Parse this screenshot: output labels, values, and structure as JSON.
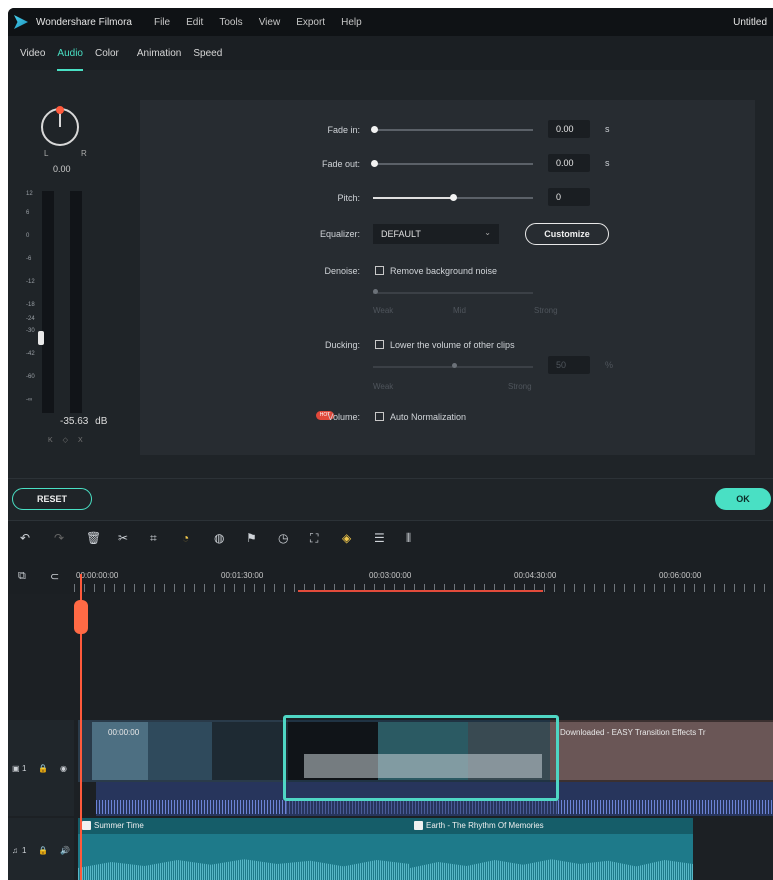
{
  "menubar": {
    "app_name": "Wondershare Filmora",
    "menus": [
      "File",
      "Edit",
      "Tools",
      "View",
      "Export",
      "Help"
    ],
    "window_title": "Untitled"
  },
  "tabs": [
    "Video",
    "Audio",
    "Color",
    "Animation",
    "Speed"
  ],
  "active_tab": "Audio",
  "meter": {
    "left_label": "L",
    "right_label": "R",
    "balance_value": "0.00",
    "scale": [
      "12",
      "6",
      "0",
      "-6",
      "-12",
      "-18",
      "-24",
      "-30",
      "-42",
      "-60",
      "-∞"
    ],
    "readout_value": "-35.63",
    "readout_unit": "dB",
    "icons": "K ◇ X"
  },
  "audio": {
    "fade_in_label": "Fade in:",
    "fade_in_value": "0.00",
    "fade_in_unit": "s",
    "fade_out_label": "Fade out:",
    "fade_out_value": "0.00",
    "fade_out_unit": "s",
    "pitch_label": "Pitch:",
    "pitch_value": "0",
    "equalizer_label": "Equalizer:",
    "equalizer_value": "DEFAULT",
    "customize_label": "Customize",
    "denoise_label": "Denoise:",
    "denoise_checkbox": "Remove background noise",
    "denoise_weak": "Weak",
    "denoise_mid": "Mid",
    "denoise_strong": "Strong",
    "ducking_label": "Ducking:",
    "ducking_checkbox": "Lower the volume of other clips",
    "ducking_value": "50",
    "ducking_unit": "%",
    "ducking_weak": "Weak",
    "ducking_strong": "Strong",
    "hot_badge": "HOT",
    "volume_label": "Volume:",
    "volume_checkbox": "Auto Normalization"
  },
  "footer": {
    "reset_label": "RESET",
    "ok_label": "OK"
  },
  "timeline": {
    "timecodes": [
      "00:00:00:00",
      "00:01:30:00",
      "00:03:00:00",
      "00:04:30:00",
      "00:06:00:00"
    ],
    "video_track_label": "1",
    "audio_track_label": "1",
    "video_clip_1_label": "00:00:00",
    "video_clip_3_label": "Downloaded - EASY Transition Effects Tr",
    "audio_clip_1": "Summer Time",
    "audio_clip_2": "Earth - The Rhythm Of Memories"
  },
  "colors": {
    "accent": "#49e0c4",
    "playhead": "#ff5a3c",
    "audio_clip": "#1e7a8a"
  }
}
